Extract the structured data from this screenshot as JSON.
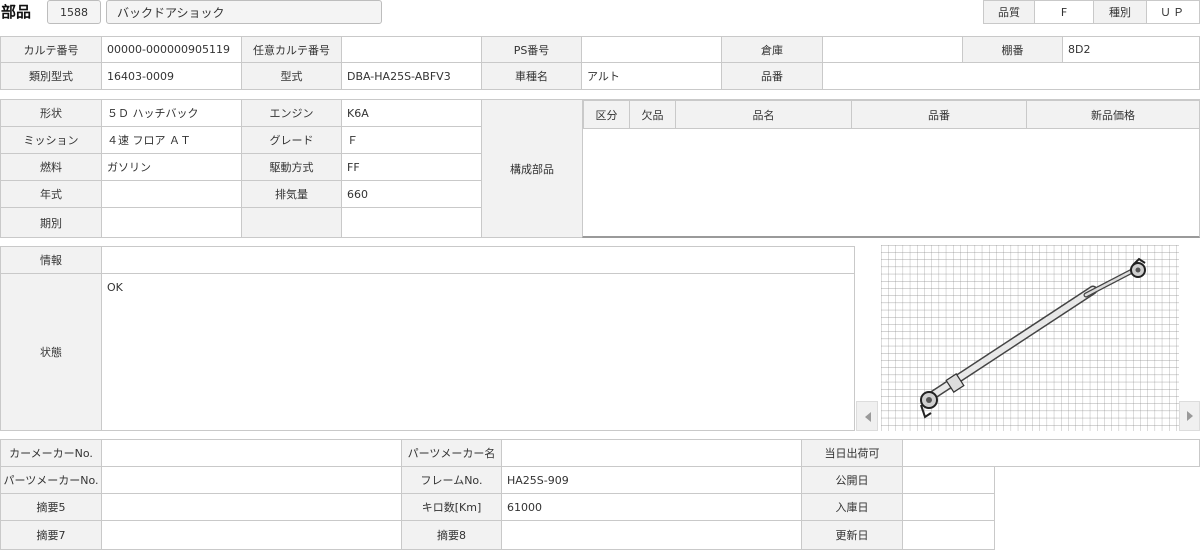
{
  "header": {
    "title": "部品",
    "part_code": "1588",
    "part_name": "バックドアショック",
    "quality_label": "品質",
    "quality_value": "F",
    "kind_label": "種別",
    "kind_value": "ＵＰ"
  },
  "row1": {
    "karte_no_label": "カルテ番号",
    "karte_no_value": "00000-000000905119",
    "any_karte_label": "任意カルテ番号",
    "any_karte_value": "",
    "ps_no_label": "PS番号",
    "ps_no_value": "",
    "warehouse_label": "倉庫",
    "warehouse_value": "",
    "shelf_label": "棚番",
    "shelf_value": "8D2"
  },
  "row2": {
    "class_model_label": "類別型式",
    "class_model_value": "16403-0009",
    "model_label": "型式",
    "model_value": "DBA-HA25S-ABFV3",
    "car_name_label": "車種名",
    "car_name_value": "アルト",
    "part_no_label": "品番",
    "part_no_value": ""
  },
  "spec": {
    "shape_label": "形状",
    "shape_value": "５Ｄ ハッチバック",
    "engine_label": "エンジン",
    "engine_value": "K6A",
    "mission_label": "ミッション",
    "mission_value": "４速 フロア ＡＴ",
    "grade_label": "グレード",
    "grade_value": "Ｆ",
    "fuel_label": "燃料",
    "fuel_value": "ガソリン",
    "drive_label": "駆動方式",
    "drive_value": "FF",
    "year_label": "年式",
    "year_value": "",
    "displacement_label": "排気量",
    "displacement_value": "660",
    "period_label": "期別",
    "period_value": "",
    "components_label": "構成部品"
  },
  "components_table": {
    "headers": [
      "区分",
      "欠品",
      "品名",
      "品番",
      "新品価格"
    ]
  },
  "info": {
    "info_label": "情報",
    "info_value": "",
    "status_label": "状態",
    "status_value": "OK"
  },
  "gallery": {
    "prev_icon": "chevron-left-icon",
    "next_icon": "chevron-right-icon"
  },
  "bottom": {
    "car_maker_no_label": "カーメーカーNo.",
    "car_maker_no_value": "",
    "parts_maker_name_label": "パーツメーカー名",
    "parts_maker_name_value": "",
    "same_day_label": "当日出荷可",
    "same_day_value": "",
    "parts_maker_no_label": "パーツメーカーNo.",
    "parts_maker_no_value": "",
    "frame_no_label": "フレームNo.",
    "frame_no_value": "HA25S-909",
    "publish_date_label": "公開日",
    "publish_date_value": "",
    "note5_label": "摘要5",
    "note5_value": "",
    "km_label": "キロ数[Km]",
    "km_value": "61000",
    "arrival_date_label": "入庫日",
    "arrival_date_value": "",
    "note7_label": "摘要7",
    "note7_value": "",
    "note8_label": "摘要8",
    "note8_value": "",
    "update_date_label": "更新日",
    "update_date_value": ""
  }
}
